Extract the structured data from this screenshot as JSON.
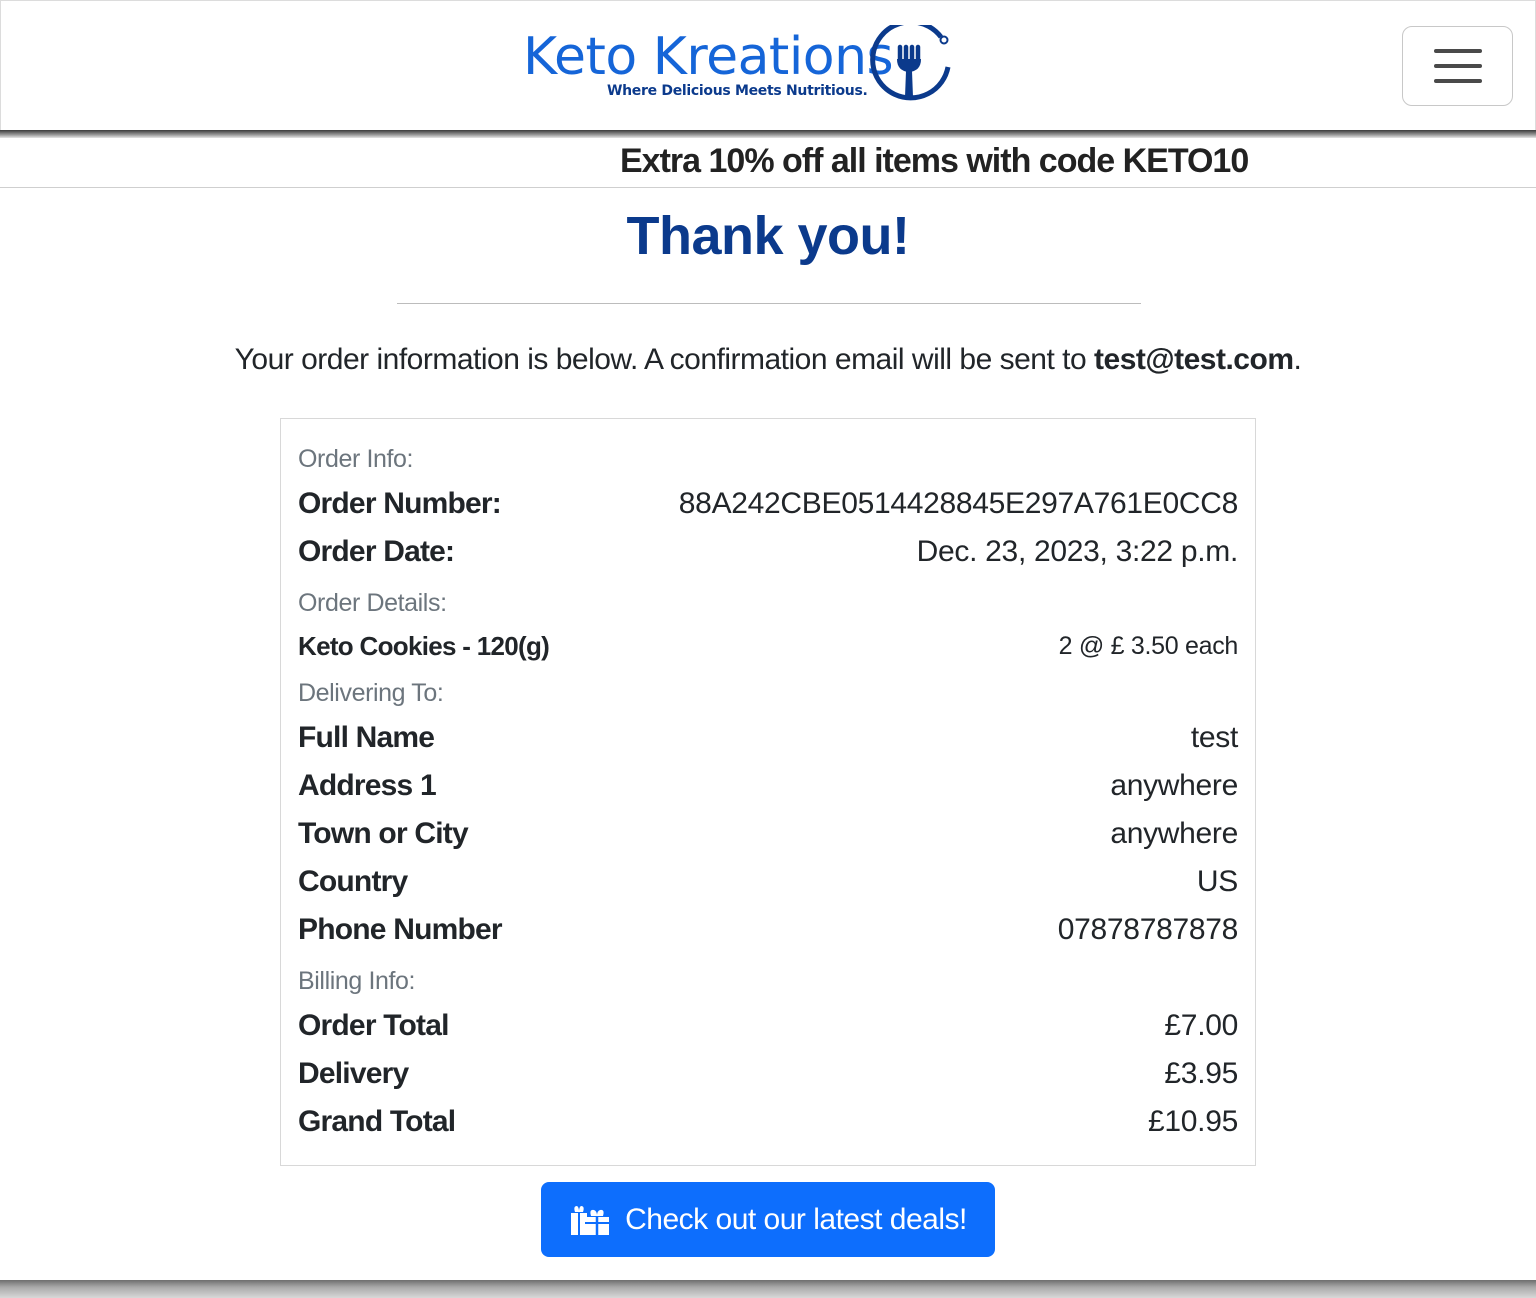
{
  "header": {
    "brand_name": "Keto Kreations",
    "tagline": "Where Delicious Meets Nutritious.",
    "logo_icon": "fork-icon",
    "menu_icon": "hamburger-icon",
    "brand_color": "#1565d8"
  },
  "promo": {
    "text": "Extra 10% off all items with code KETO10"
  },
  "main": {
    "title": "Thank you!",
    "intro_text": "Your order information is below. A confirmation email will be sent to ",
    "email": "test@test.com",
    "intro_end": "."
  },
  "order": {
    "order_info_label": "Order Info:",
    "order_number_label": "Order Number:",
    "order_number": "88A242CBE0514428845E297A761E0CC8",
    "order_date_label": "Order Date:",
    "order_date": "Dec. 23, 2023, 3:22 p.m.",
    "order_details_label": "Order Details:",
    "items": [
      {
        "name": "Keto Cookies - 120(g)",
        "qty_price": "2 @ £ 3.50 each"
      }
    ],
    "delivering_label": "Delivering To:",
    "delivery": [
      {
        "label": "Full Name",
        "value": "test"
      },
      {
        "label": "Address 1",
        "value": "anywhere"
      },
      {
        "label": "Town or City",
        "value": "anywhere"
      },
      {
        "label": "Country",
        "value": "US"
      },
      {
        "label": "Phone Number",
        "value": "07878787878"
      }
    ],
    "billing_label": "Billing Info:",
    "billing": [
      {
        "label": "Order Total",
        "value": "£7.00"
      },
      {
        "label": "Delivery",
        "value": "£3.95"
      },
      {
        "label": "Grand Total",
        "value": "£10.95"
      }
    ]
  },
  "cta": {
    "label": "Check out our latest deals!",
    "icon": "gifts-icon",
    "color": "#0d6efd"
  }
}
